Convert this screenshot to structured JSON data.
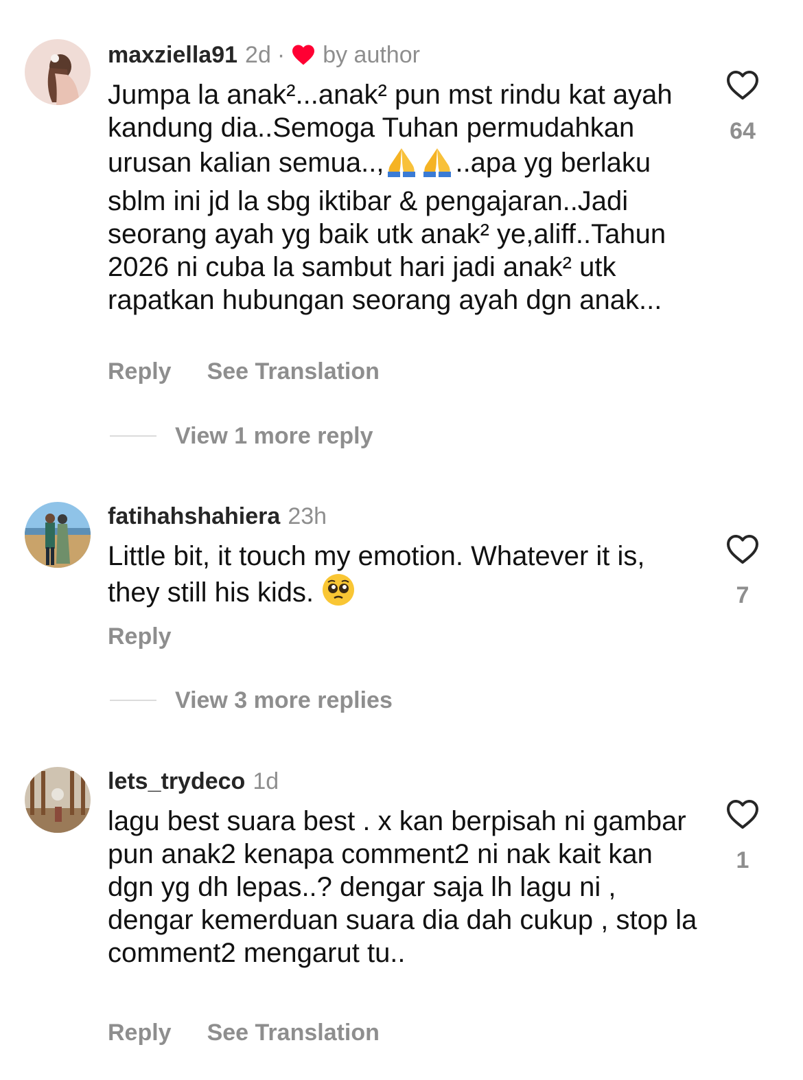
{
  "comments": [
    {
      "username": "maxziella91",
      "time": "2d",
      "separator": "·",
      "author_like_label": "by author",
      "text_parts": [
        "Jumpa la anak²...anak² pun mst rindu kat ayah kandung dia..Semoga Tuhan permudahkan urusan kalian semua..,",
        "..apa yg berlaku sblm ini jd la sbg iktibar & pengajaran..Jadi seorang ayah yg baik utk anak² ye,aliff..Tahun 2026 ni cuba la sambut hari jadi anak² utk rapatkan hubungan seorang ayah dgn anak..."
      ],
      "emoji": "folded-hands",
      "reply_label": "Reply",
      "translate_label": "See Translation",
      "view_more": "View 1 more reply",
      "likes": "64"
    },
    {
      "username": "fatihahshahiera",
      "time": "23h",
      "text": "Little bit, it touch my emotion. Whatever it is, they still his kids.",
      "emoji": "pleading-face",
      "reply_label": "Reply",
      "view_more": "View 3 more replies",
      "likes": "7"
    },
    {
      "username": "lets_trydeco",
      "time": "1d",
      "text": "lagu best suara best . x kan berpisah ni gambar pun anak2 kenapa comment2  ni nak kait kan dgn yg dh lepas..? dengar saja lh lagu ni , dengar kemerduan suara dia dah cukup , stop la comment2 mengarut tu..",
      "reply_label": "Reply",
      "translate_label": "See Translation",
      "likes": "1"
    }
  ],
  "colors": {
    "text": "#111111",
    "username": "#262626",
    "secondary": "#8e8e8e",
    "author_heart": "#ff0033",
    "divider": "#dbdbdb"
  }
}
